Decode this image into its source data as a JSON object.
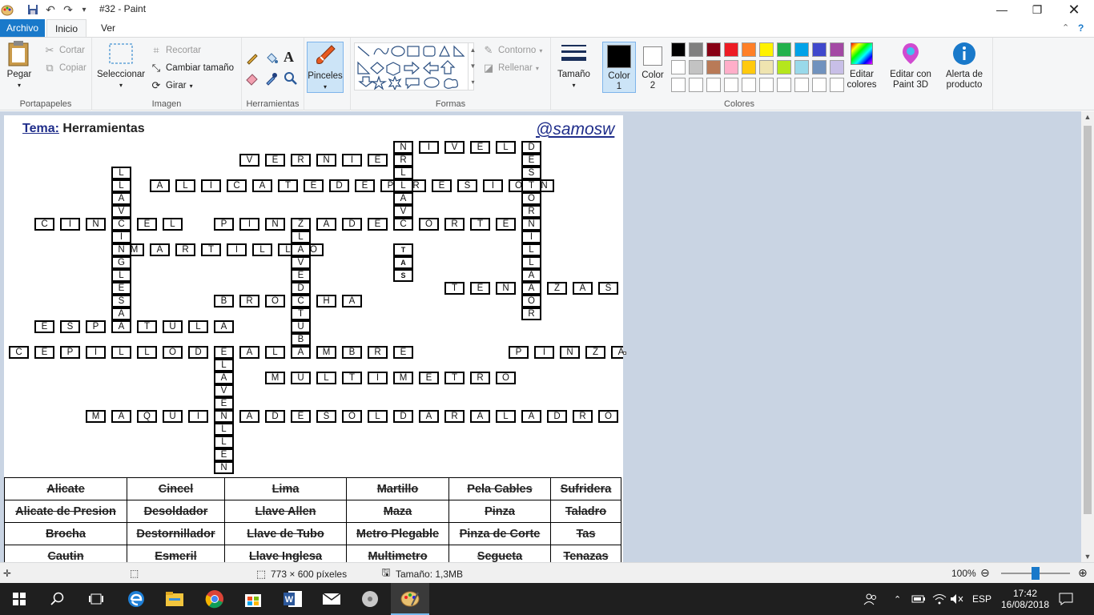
{
  "window": {
    "title": "#32 - Paint"
  },
  "tabs": [
    "Archivo",
    "Inicio",
    "Ver"
  ],
  "ribbon": {
    "clipboard": {
      "label": "Portapapeles",
      "paste": "Pegar",
      "cut": "Cortar",
      "copy": "Copiar"
    },
    "image": {
      "label": "Imagen",
      "select": "Seleccionar",
      "crop": "Recortar",
      "resize": "Cambiar tamaño",
      "rotate": "Girar"
    },
    "tools": {
      "label": "Herramientas"
    },
    "brushes": {
      "label": "Pinceles"
    },
    "shapes": {
      "label": "Formas",
      "outline": "Contorno",
      "fill": "Rellenar"
    },
    "size": {
      "label": "Tamaño"
    },
    "colors": {
      "label": "Colores",
      "color1": "Color 1",
      "color2": "Color 2",
      "edit": "Editar colores",
      "paint3d": "Editar con Paint 3D",
      "alert": "Alerta de producto",
      "palette_row1": [
        "#000000",
        "#7f7f7f",
        "#880015",
        "#ed1c24",
        "#ff7f27",
        "#fff200",
        "#22b14c",
        "#00a2e8",
        "#3f48cc",
        "#a349a4"
      ],
      "palette_row2": [
        "#ffffff",
        "#c3c3c3",
        "#b97a57",
        "#ffaec9",
        "#ffc90e",
        "#efe4b0",
        "#b5e61d",
        "#99d9ea",
        "#7092be",
        "#c8bfe7"
      ]
    }
  },
  "canvas": {
    "theme_label": "Tema:",
    "theme_value": "Herramientas",
    "handle": "@samosw"
  },
  "crossword": {
    "across": [
      {
        "row": 1,
        "col": 30,
        "word": "NIVEL"
      },
      {
        "row": 2,
        "col": 18,
        "word": "VERNIER"
      },
      {
        "row": 4,
        "col": 11,
        "word": "ALICATEDEPRESION"
      },
      {
        "row": 7,
        "col": 2,
        "word": "CINCEL"
      },
      {
        "row": 7,
        "col": 16,
        "word": "PINZADECORTE"
      },
      {
        "row": 9,
        "col": 9,
        "word": "MARTILLO"
      },
      {
        "row": 12,
        "col": 34,
        "word": "TENAZAS"
      },
      {
        "row": 13,
        "col": 16,
        "word": "BROCHA"
      },
      {
        "row": 15,
        "col": 2,
        "word": "ESPATULA"
      },
      {
        "row": 17,
        "col": 0,
        "word": "CEPILLODEALAMBRE"
      },
      {
        "row": 17,
        "col": 39,
        "word": "PINZA"
      },
      {
        "row": 19,
        "col": 20,
        "word": "MULTIMETRO"
      },
      {
        "row": 22,
        "col": 6,
        "word": "MAQUINADESOLDAR"
      },
      {
        "row": 22,
        "col": 34,
        "word": "TALADRO"
      }
    ],
    "down": [
      {
        "row": 0,
        "col": 36,
        "word": "METROPLEGABLE"
      },
      {
        "row": 1,
        "col": 20,
        "word": "DESTORNILLADOR"
      },
      {
        "row": 3,
        "col": 4,
        "word": "LLAVEINGLESA"
      },
      {
        "row": 3,
        "col": 15,
        "word": "LLAVE"
      },
      {
        "row": 4,
        "col": 43,
        "word": "SUFRIDER"
      },
      {
        "row": 5,
        "col": 27,
        "word": "SEGUETA"
      },
      {
        "row": 5,
        "col": 32,
        "word": "SERRUCHO"
      },
      {
        "row": 7,
        "col": 11,
        "word": "LLAVEDETUBO"
      },
      {
        "row": 8,
        "col": 39,
        "word": "ALICATE"
      },
      {
        "row": 14,
        "col": 27,
        "word": "ESMERIL"
      },
      {
        "row": 16,
        "col": 32,
        "word": "CAUTIN"
      },
      {
        "row": 16,
        "col": 36,
        "word": "DESOLDADOR"
      },
      {
        "row": 16,
        "col": 45,
        "word": "MAZA"
      },
      {
        "row": 17,
        "col": 8,
        "word": "LLAVEALLEN"
      },
      {
        "row": 17,
        "col": 39,
        "word": "PELACABLES"
      }
    ],
    "tas_cells": [
      {
        "row": 9,
        "col": 15,
        "text": "T"
      },
      {
        "row": 10,
        "col": 15,
        "text": "A"
      },
      {
        "row": 11,
        "col": 15,
        "text": "S"
      }
    ]
  },
  "word_list": [
    [
      "Alicate",
      "Cincel",
      "Lima",
      "Martillo",
      "Pela Cables",
      "Sufridera"
    ],
    [
      "Alicate de Presion",
      "Desoldador",
      "Llave Allen",
      "Maza",
      "Pinza",
      "Taladro"
    ],
    [
      "Brocha",
      "Destornillador",
      "Llave de Tubo",
      "Metro Plegable",
      "Pinza de Corte",
      "Tas"
    ],
    [
      "Cautin",
      "Esmeril",
      "Llave Inglesa",
      "Multimetro",
      "Segueta",
      "Tenazas"
    ]
  ],
  "status": {
    "dimensions": "773 × 600 píxeles",
    "size": "Tamaño: 1,3MB",
    "zoom": "100%",
    "zoom_fraction": 0.5
  },
  "taskbar": {
    "lang": "ESP",
    "time": "17:42",
    "date": "16/08/2018"
  }
}
